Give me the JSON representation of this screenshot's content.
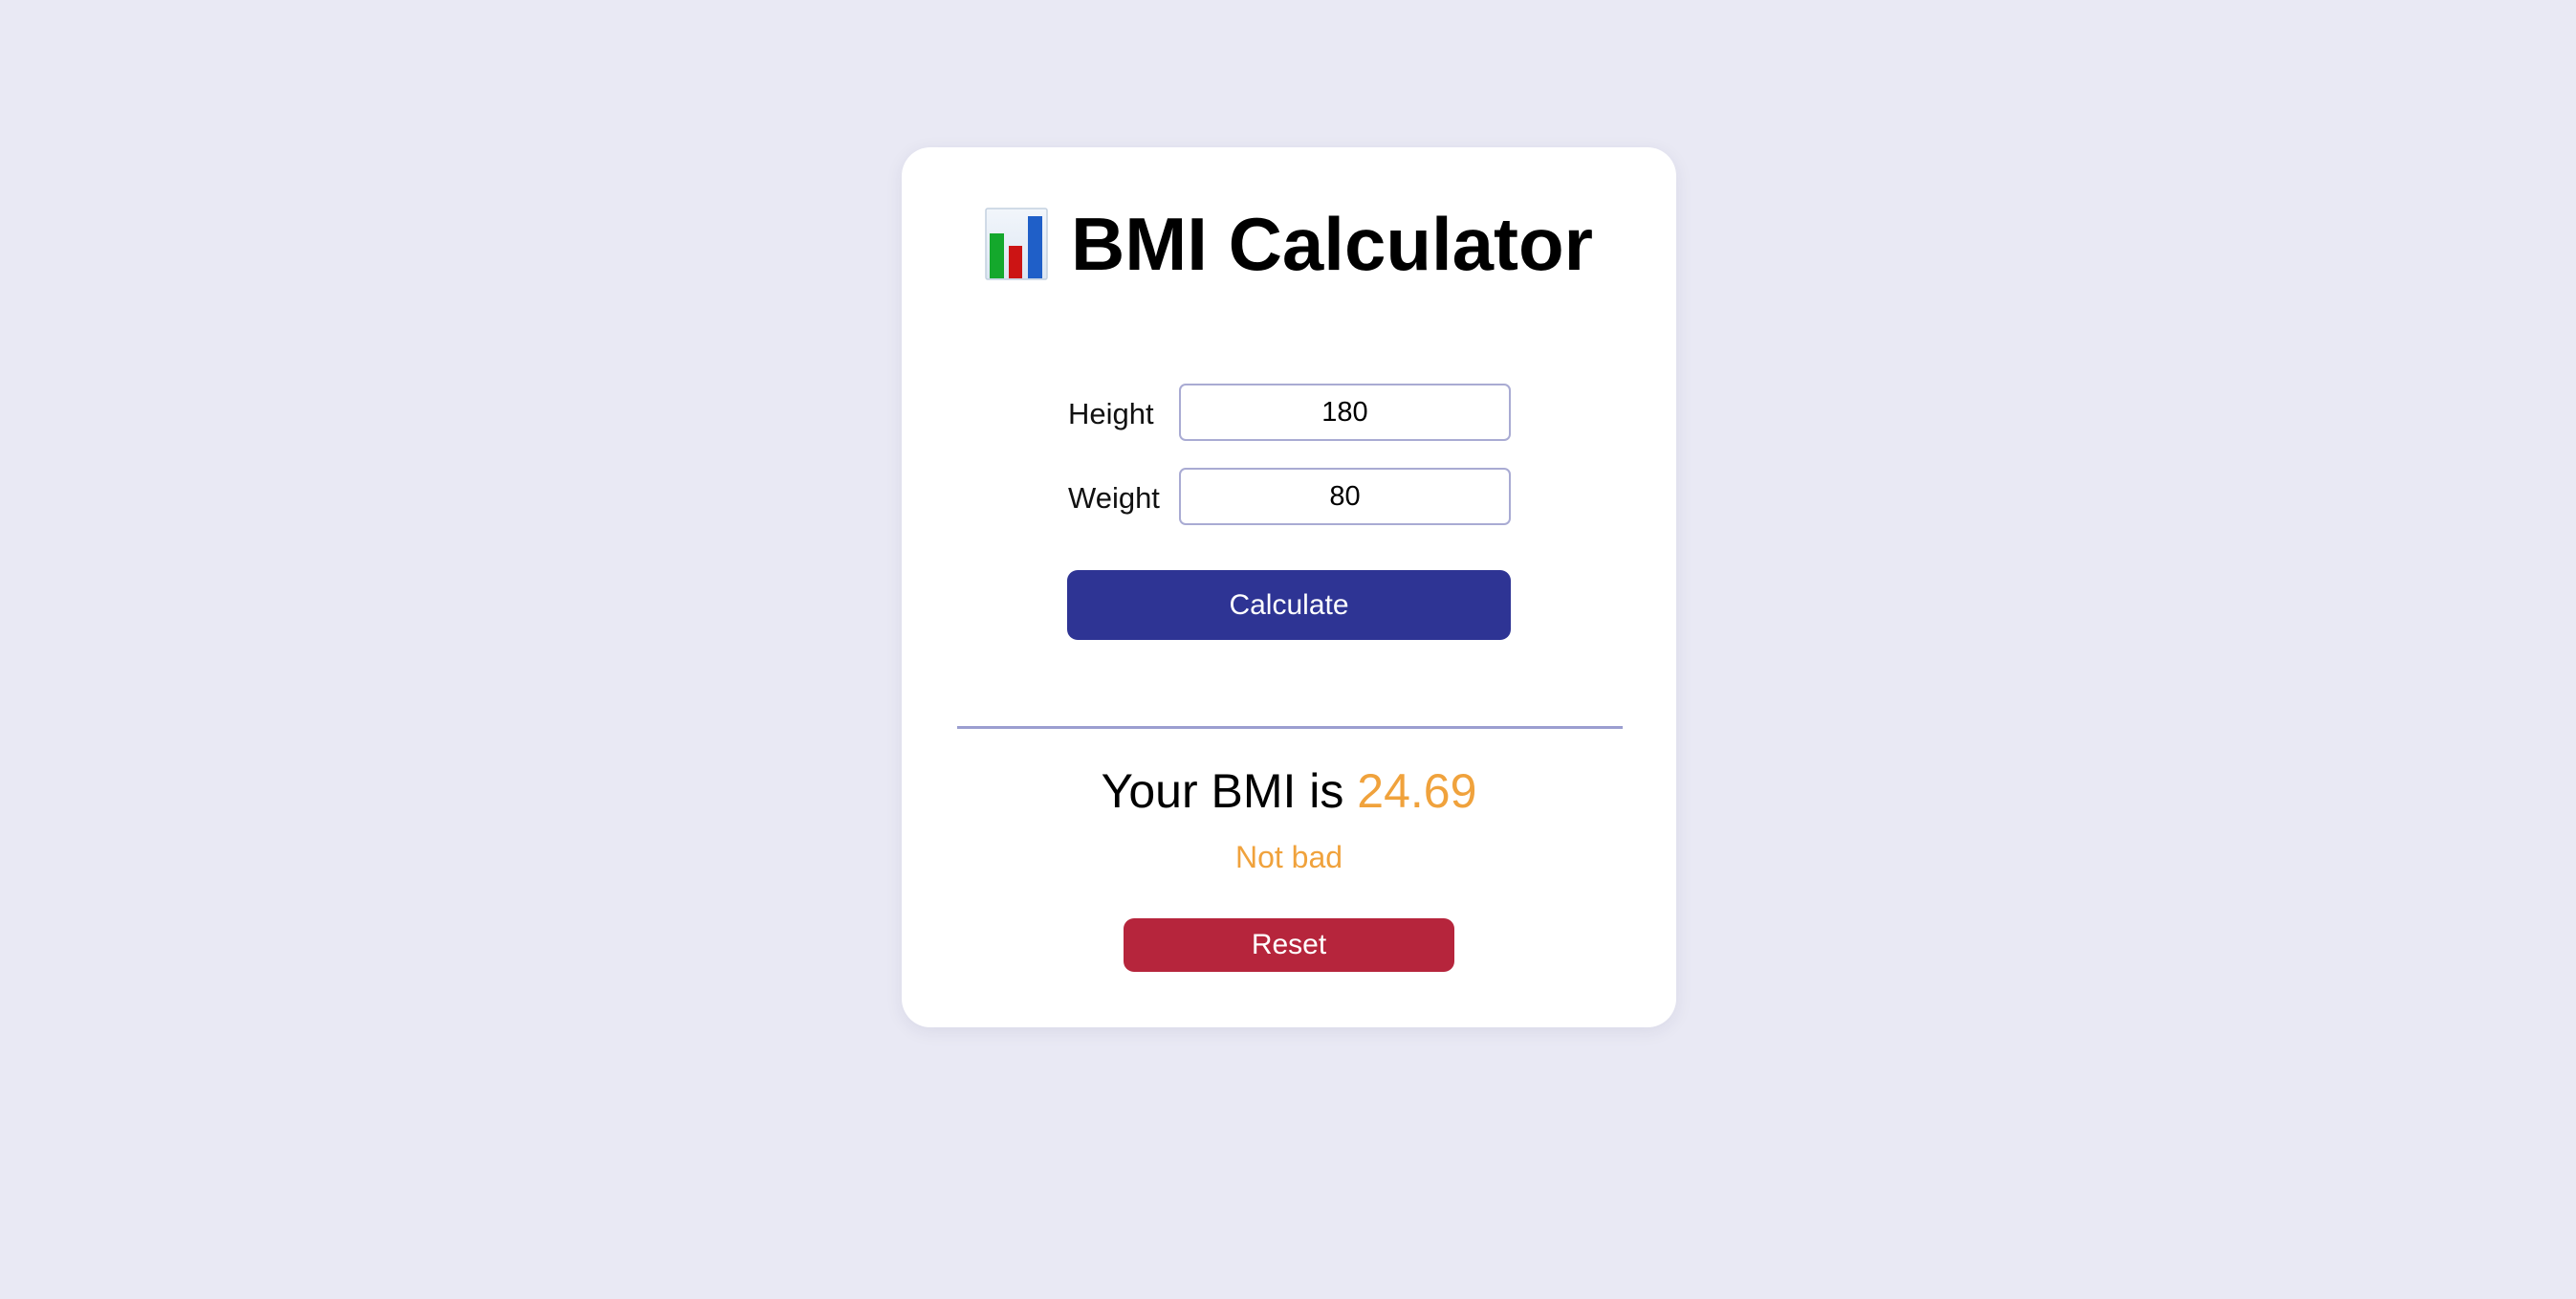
{
  "header": {
    "title": "BMI Calculator",
    "icon": "bar-chart-icon"
  },
  "form": {
    "height_label": "Height",
    "height_value": "180",
    "weight_label": "Weight",
    "weight_value": "80",
    "calculate_label": "Calculate"
  },
  "result": {
    "prefix": "Your BMI is ",
    "value": "24.69",
    "status": "Not bad",
    "reset_label": "Reset"
  },
  "colors": {
    "background": "#e9e9f4",
    "card": "#ffffff",
    "primary_button": "#2e3494",
    "reset_button": "#b6253c",
    "result_accent": "#f0a23c",
    "input_border": "#a9abd3",
    "divider": "#9b9ed0"
  }
}
